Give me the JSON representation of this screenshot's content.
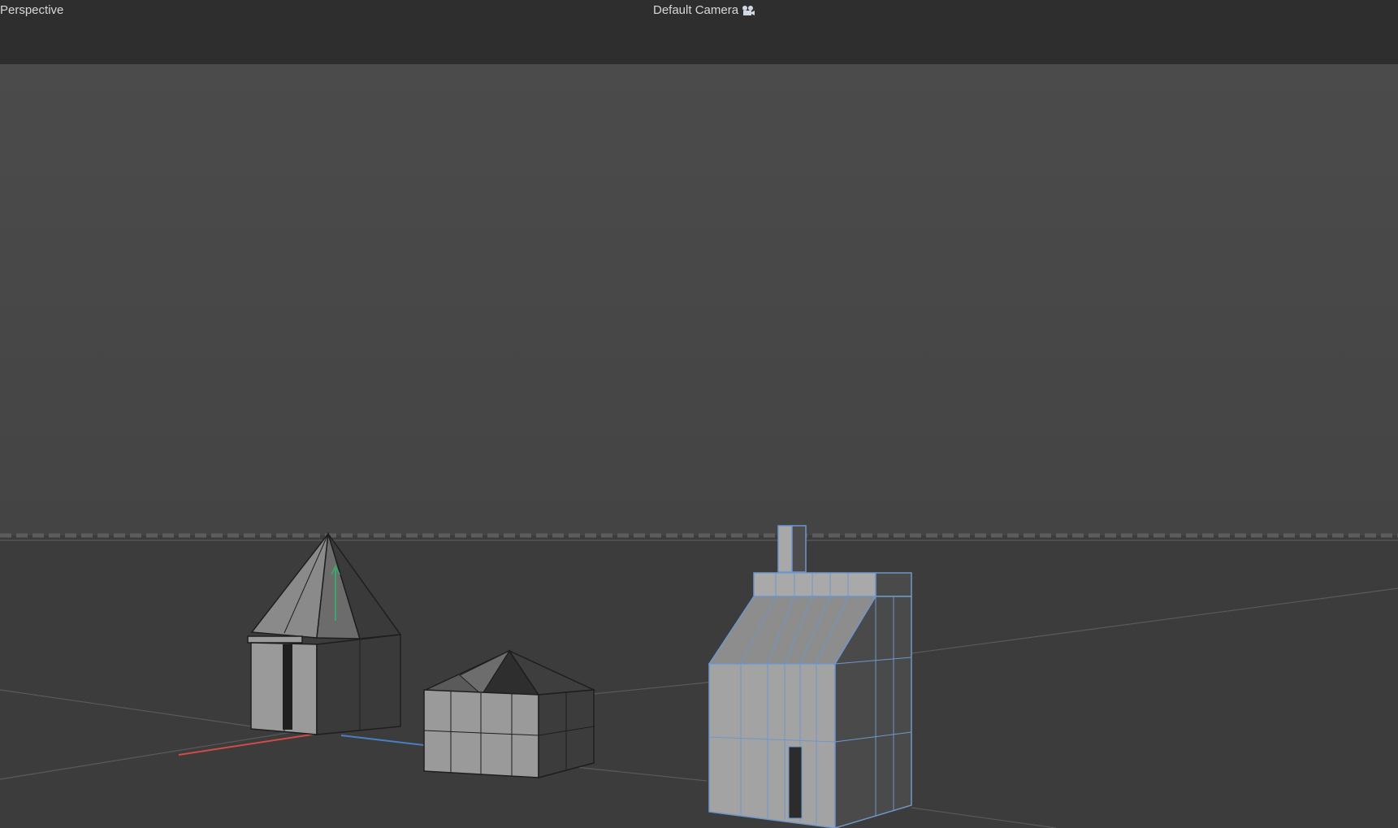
{
  "header": {
    "view_mode": "Perspective",
    "camera": "Default Camera",
    "camera_icon": "camera-icon"
  },
  "colors": {
    "header_bg": "#2e2e2e",
    "sky_top": "#4a4a4a",
    "sky_bottom": "#444444",
    "ground": "#3c3c3c",
    "selection_edge": "#6f97c9",
    "axis_x": "#d24a4a",
    "axis_y": "#3fa56b",
    "axis_z": "#4a7fc2"
  },
  "scene": {
    "objects": [
      "tent-house",
      "yurt-house",
      "selected-tall-house"
    ]
  }
}
